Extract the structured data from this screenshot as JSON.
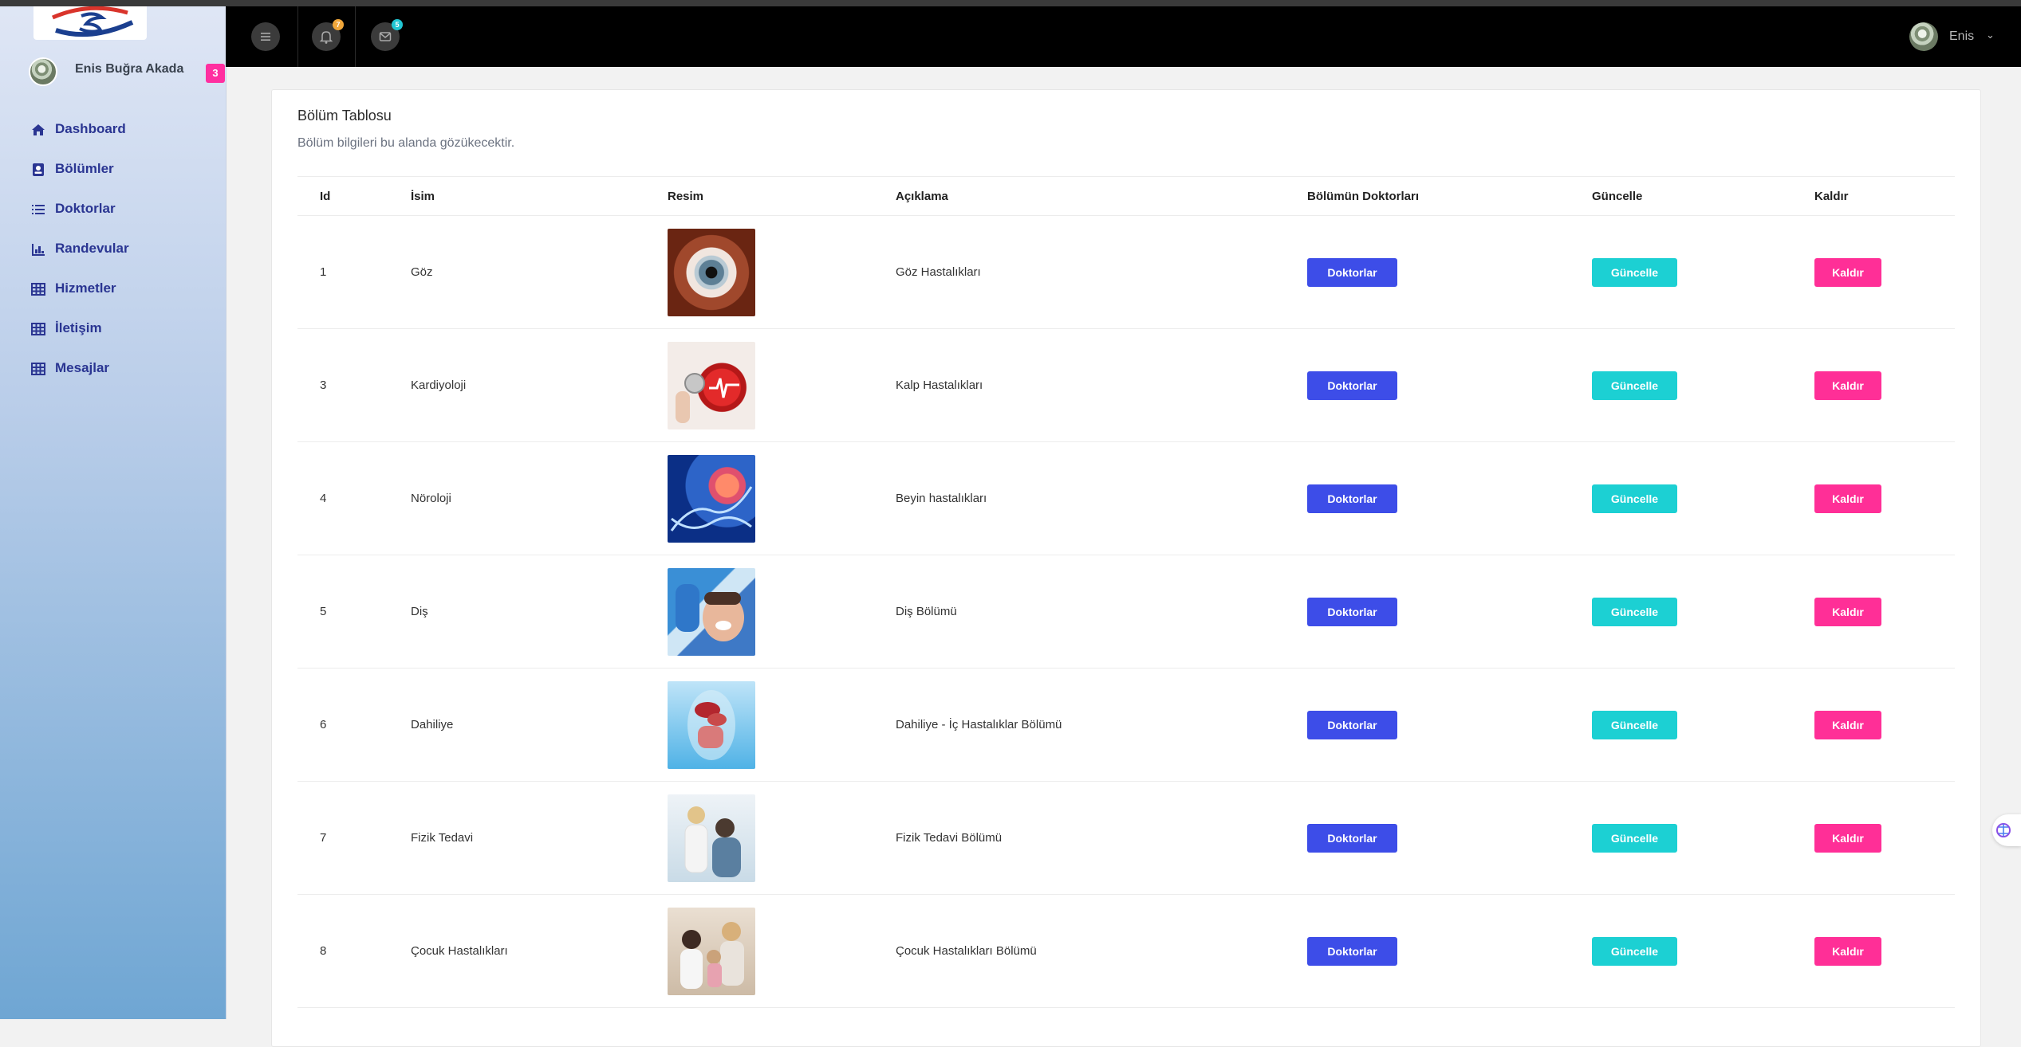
{
  "sidebar": {
    "user_name": "Enis Buğra Akada",
    "badge": "3",
    "items": [
      {
        "label": "Dashboard",
        "icon": "home-icon"
      },
      {
        "label": "Bölümler",
        "icon": "contact-card-icon"
      },
      {
        "label": "Doktorlar",
        "icon": "list-icon"
      },
      {
        "label": "Randevular",
        "icon": "bar-chart-icon"
      },
      {
        "label": "Hizmetler",
        "icon": "grid-icon"
      },
      {
        "label": "İletişim",
        "icon": "grid-icon"
      },
      {
        "label": "Mesajlar",
        "icon": "grid-icon"
      }
    ]
  },
  "header": {
    "notifications_count": "7",
    "messages_count": "5",
    "profile_name": "Enis",
    "colors": {
      "notification_badge": "#f0a63a",
      "message_badge": "#21c6d3"
    }
  },
  "card": {
    "title": "Bölüm Tablosu",
    "subtitle": "Bölüm bilgileri bu alanda gözükecektir.",
    "columns": [
      "Id",
      "İsim",
      "Resim",
      "Açıklama",
      "Bölümün Doktorları",
      "Güncelle",
      "Kaldır"
    ],
    "buttons": {
      "doctors": "Doktorlar",
      "update": "Güncelle",
      "remove": "Kaldır"
    },
    "rows": [
      {
        "id": "1",
        "name": "Göz",
        "image": "eye-photo",
        "description": "Göz Hastalıkları"
      },
      {
        "id": "3",
        "name": "Kardiyoloji",
        "image": "heart-stethoscope-photo",
        "description": "Kalp Hastalıkları"
      },
      {
        "id": "4",
        "name": "Nöroloji",
        "image": "brain-dna-photo",
        "description": "Beyin hastalıkları"
      },
      {
        "id": "5",
        "name": "Diş",
        "image": "dentist-patient-photo",
        "description": "Diş Bölümü"
      },
      {
        "id": "6",
        "name": "Dahiliye",
        "image": "internal-organs-photo",
        "description": "Dahiliye - İç Hastalıklar Bölümü"
      },
      {
        "id": "7",
        "name": "Fizik Tedavi",
        "image": "physiotherapy-photo",
        "description": "Fizik Tedavi Bölümü"
      },
      {
        "id": "8",
        "name": "Çocuk Hastalıkları",
        "image": "pediatrics-photo",
        "description": "Çocuk Hastalıkları Bölümü"
      }
    ]
  },
  "colors": {
    "doctors_button": "#3d4de8",
    "update_button": "#1cd0d3",
    "remove_button": "#ff2f97",
    "nav_text": "#2a3592"
  }
}
